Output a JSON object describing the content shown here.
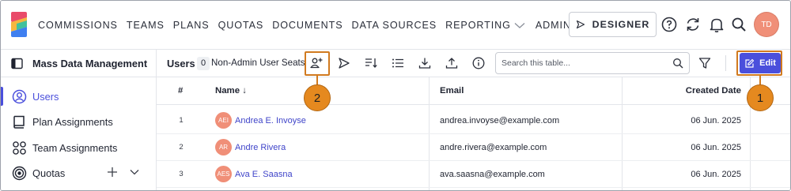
{
  "nav": {
    "items": [
      {
        "label": "COMMISSIONS",
        "has_dropdown": false
      },
      {
        "label": "TEAMS",
        "has_dropdown": false
      },
      {
        "label": "PLANS",
        "has_dropdown": false
      },
      {
        "label": "QUOTAS",
        "has_dropdown": false
      },
      {
        "label": "DOCUMENTS",
        "has_dropdown": false
      },
      {
        "label": "DATA SOURCES",
        "has_dropdown": false
      },
      {
        "label": "REPORTING",
        "has_dropdown": true
      },
      {
        "label": "ADMIN",
        "has_dropdown": true
      }
    ],
    "designer_label": "DESIGNER",
    "user_initials": "TD"
  },
  "sidebar": {
    "title": "Mass Data Management",
    "items": [
      {
        "label": "Users",
        "icon": "user-circle-icon",
        "active": true
      },
      {
        "label": "Plan Assignments",
        "icon": "book-icon",
        "active": false
      },
      {
        "label": "Team Assignments",
        "icon": "team-icon",
        "active": false
      },
      {
        "label": "Quotas",
        "icon": "target-icon",
        "active": false
      }
    ]
  },
  "toolbar": {
    "title": "Users",
    "count": "0",
    "seats_label": "Non-Admin User Seats",
    "search_placeholder": "Search this table...",
    "edit_label": "Edit"
  },
  "callouts": {
    "edit": "1",
    "add_user": "2"
  },
  "table": {
    "columns": [
      "#",
      "Name",
      "Email",
      "Created Date"
    ],
    "sort_indicator": "↓",
    "rows": [
      {
        "num": "1",
        "initials": "AEI",
        "name": "Andrea E. Invoyse",
        "email": "andrea.invoyse@example.com",
        "created": "06 Jun. 2025"
      },
      {
        "num": "2",
        "initials": "AR",
        "name": "Andre Rivera",
        "email": "andre.rivera@example.com",
        "created": "06 Jun. 2025"
      },
      {
        "num": "3",
        "initials": "AES",
        "name": "Ava E. Saasna",
        "email": "ava.saasna@example.com",
        "created": "06 Jun. 2025"
      }
    ]
  },
  "colors": {
    "accent": "#4a4fdc",
    "avatar": "#f08f78",
    "callout": "#e5891f"
  }
}
